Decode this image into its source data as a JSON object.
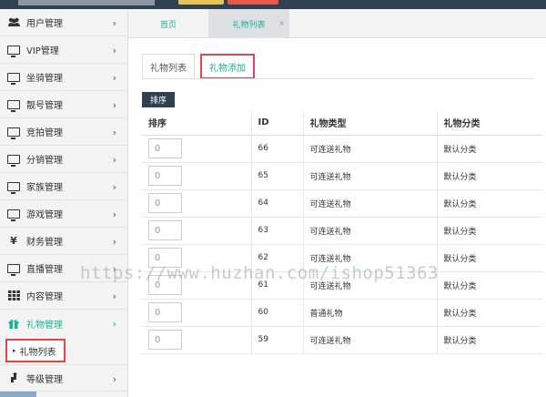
{
  "sidebar": {
    "items": [
      {
        "label": "用户管理",
        "icon": "users-icon"
      },
      {
        "label": "VIP管理",
        "icon": "monitor-icon"
      },
      {
        "label": "坐骑管理",
        "icon": "monitor-icon"
      },
      {
        "label": "靓号管理",
        "icon": "monitor-icon"
      },
      {
        "label": "竞拍管理",
        "icon": "monitor-icon"
      },
      {
        "label": "分销管理",
        "icon": "monitor-icon"
      },
      {
        "label": "家族管理",
        "icon": "monitor-icon"
      },
      {
        "label": "游戏管理",
        "icon": "monitor-icon"
      },
      {
        "label": "财务管理",
        "icon": "yen-icon"
      },
      {
        "label": "直播管理",
        "icon": "monitor-icon"
      },
      {
        "label": "内容管理",
        "icon": "grid-icon"
      },
      {
        "label": "礼物管理",
        "icon": "gift-icon"
      },
      {
        "label": "等级管理",
        "icon": "level-up-icon"
      }
    ],
    "sub_item": "礼物列表",
    "arrow": "›",
    "tri": "▸"
  },
  "tabs": {
    "home": "首页",
    "current": "礼物列表",
    "close": "×"
  },
  "subtabs": {
    "list": "礼物列表",
    "add": "礼物添加"
  },
  "sort_button": "排序",
  "table": {
    "headers": [
      "排序",
      "ID",
      "礼物类型",
      "礼物分类"
    ],
    "rows": [
      {
        "sort": "0",
        "id": "66",
        "type": "可连送礼物",
        "category": "默认分类"
      },
      {
        "sort": "0",
        "id": "65",
        "type": "可连送礼物",
        "category": "默认分类"
      },
      {
        "sort": "0",
        "id": "64",
        "type": "可连送礼物",
        "category": "默认分类"
      },
      {
        "sort": "0",
        "id": "63",
        "type": "可连送礼物",
        "category": "默认分类"
      },
      {
        "sort": "0",
        "id": "62",
        "type": "可连送礼物",
        "category": "默认分类"
      },
      {
        "sort": "0",
        "id": "61",
        "type": "可连送礼物",
        "category": "默认分类"
      },
      {
        "sort": "0",
        "id": "60",
        "type": "普通礼物",
        "category": "默认分类"
      },
      {
        "sort": "0",
        "id": "59",
        "type": "可连送礼物",
        "category": "默认分类"
      }
    ]
  },
  "watermark": "https://www.huzhan.com/ishop51363",
  "colors": {
    "accent": "#1ab394",
    "dark": "#2f4050",
    "highlight_border": "#e04848"
  }
}
